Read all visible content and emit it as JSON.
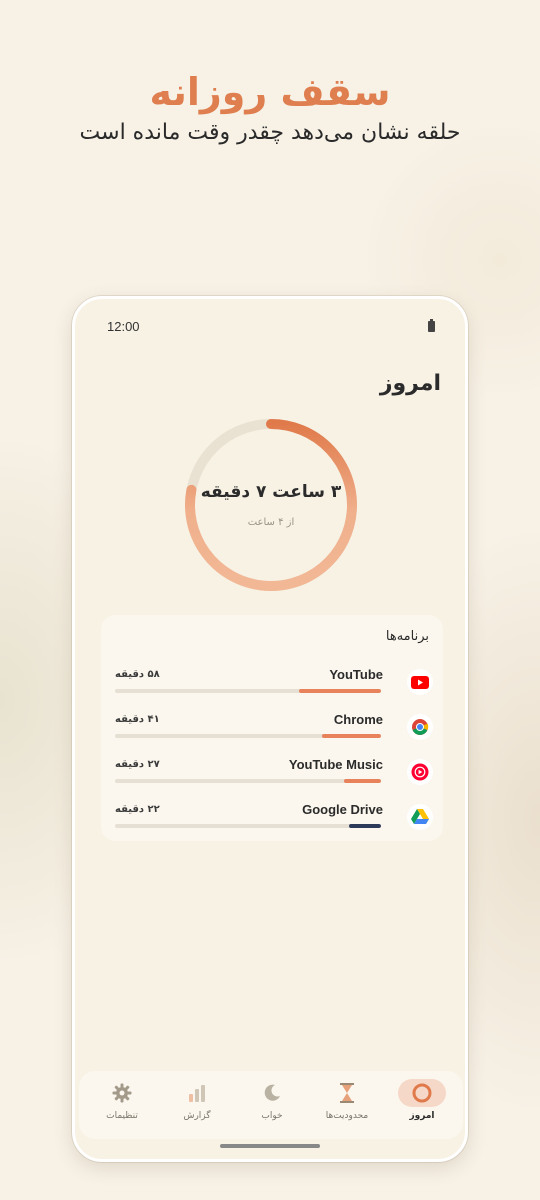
{
  "promo": {
    "title": "سقف روزانه",
    "subtitle": "حلقه نشان می‌دهد چقدر وقت مانده است"
  },
  "status_bar": {
    "time": "12:00",
    "battery_icon": "battery-icon"
  },
  "screen": {
    "title": "امروز"
  },
  "ring": {
    "main_text": "۳ ساعت ۷ دقیقه",
    "sub_text": "از ۴ ساعت",
    "used_fraction": 0.78,
    "colors": {
      "track": "#e9e2d3",
      "dark": "#e38558",
      "light": "#f0b693"
    }
  },
  "apps": {
    "title": "برنامه‌ها",
    "items": [
      {
        "name": "YouTube",
        "time": "۵۸ دقیقه",
        "fraction": 0.31,
        "color": "#e8825a",
        "icon": "youtube-icon"
      },
      {
        "name": "Chrome",
        "time": "۴۱ دقیقه",
        "fraction": 0.22,
        "color": "#e8825a",
        "icon": "chrome-icon"
      },
      {
        "name": "YouTube Music",
        "time": "۲۷ دقیقه",
        "fraction": 0.14,
        "color": "#e8825a",
        "icon": "youtube-music-icon"
      },
      {
        "name": "Google Drive",
        "time": "۲۲ دقیقه",
        "fraction": 0.12,
        "color": "#2d3a5a",
        "icon": "google-drive-icon"
      }
    ]
  },
  "nav": {
    "items": [
      {
        "label": "امروز",
        "icon": "ring-icon",
        "active": true
      },
      {
        "label": "محدودیت‌ها",
        "icon": "hourglass-icon",
        "active": false
      },
      {
        "label": "خواب",
        "icon": "moon-icon",
        "active": false
      },
      {
        "label": "گزارش",
        "icon": "bar-chart-icon",
        "active": false
      },
      {
        "label": "تنظیمات",
        "icon": "gear-icon",
        "active": false
      }
    ]
  }
}
